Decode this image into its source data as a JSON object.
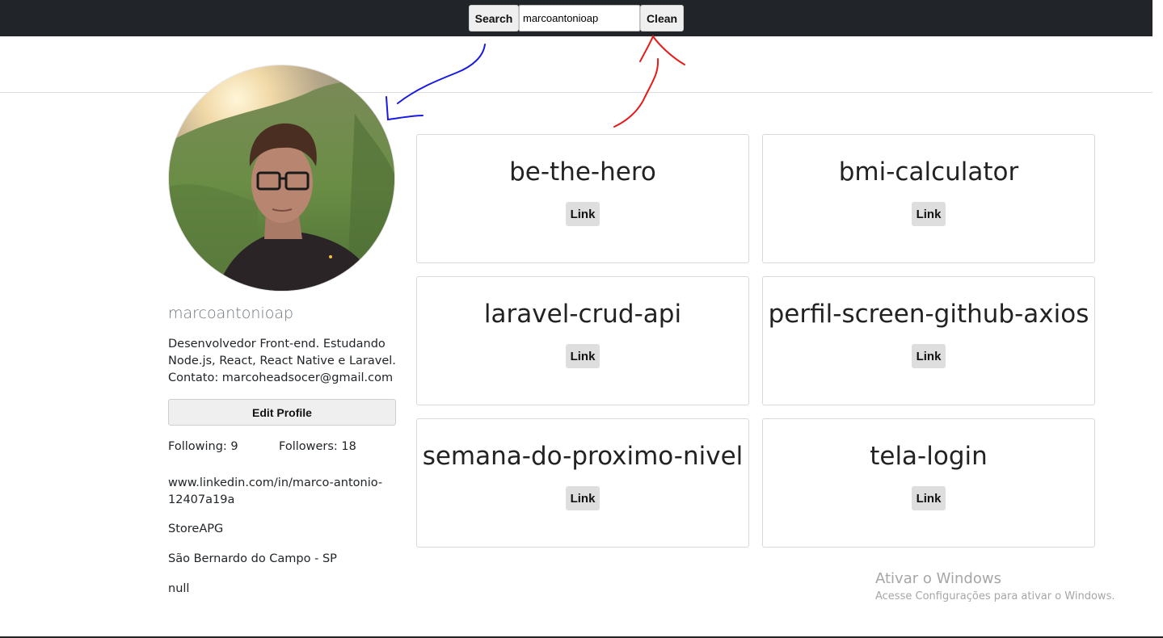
{
  "header": {
    "search_label": "Search",
    "search_value": "marcoantonioap",
    "clean_label": "Clean"
  },
  "profile": {
    "username": "marcoantonioap",
    "bio_lines": [
      "Desenvolvedor Front-end. Estudando",
      "Node.js, React, React Native e Laravel.",
      "Contato: marcoheadsocer@gmail.com"
    ],
    "edit_label": "Edit Profile",
    "following": "Following: 9",
    "followers": "Followers: 18",
    "blog": "www.linkedin.com/in/marco-antonio-12407a19a",
    "company": "StoreAPG",
    "location": "São Bernardo do Campo - SP",
    "extra": "null"
  },
  "repos": [
    {
      "name": "be-the-hero",
      "link_label": "Link"
    },
    {
      "name": "bmi-calculator",
      "link_label": "Link"
    },
    {
      "name": "laravel-crud-api",
      "link_label": "Link"
    },
    {
      "name": "perfil-screen-github-axios",
      "link_label": "Link"
    },
    {
      "name": "semana-do-proximo-nivel",
      "link_label": "Link"
    },
    {
      "name": "tela-login",
      "link_label": "Link"
    }
  ],
  "watermark": {
    "line1": "Ativar o Windows",
    "line2": "Acesse Configurações para ativar o Windows."
  },
  "colors": {
    "navbar": "#212529",
    "annotation_blue": "#1a1ae6",
    "annotation_red": "#e61a1a"
  }
}
